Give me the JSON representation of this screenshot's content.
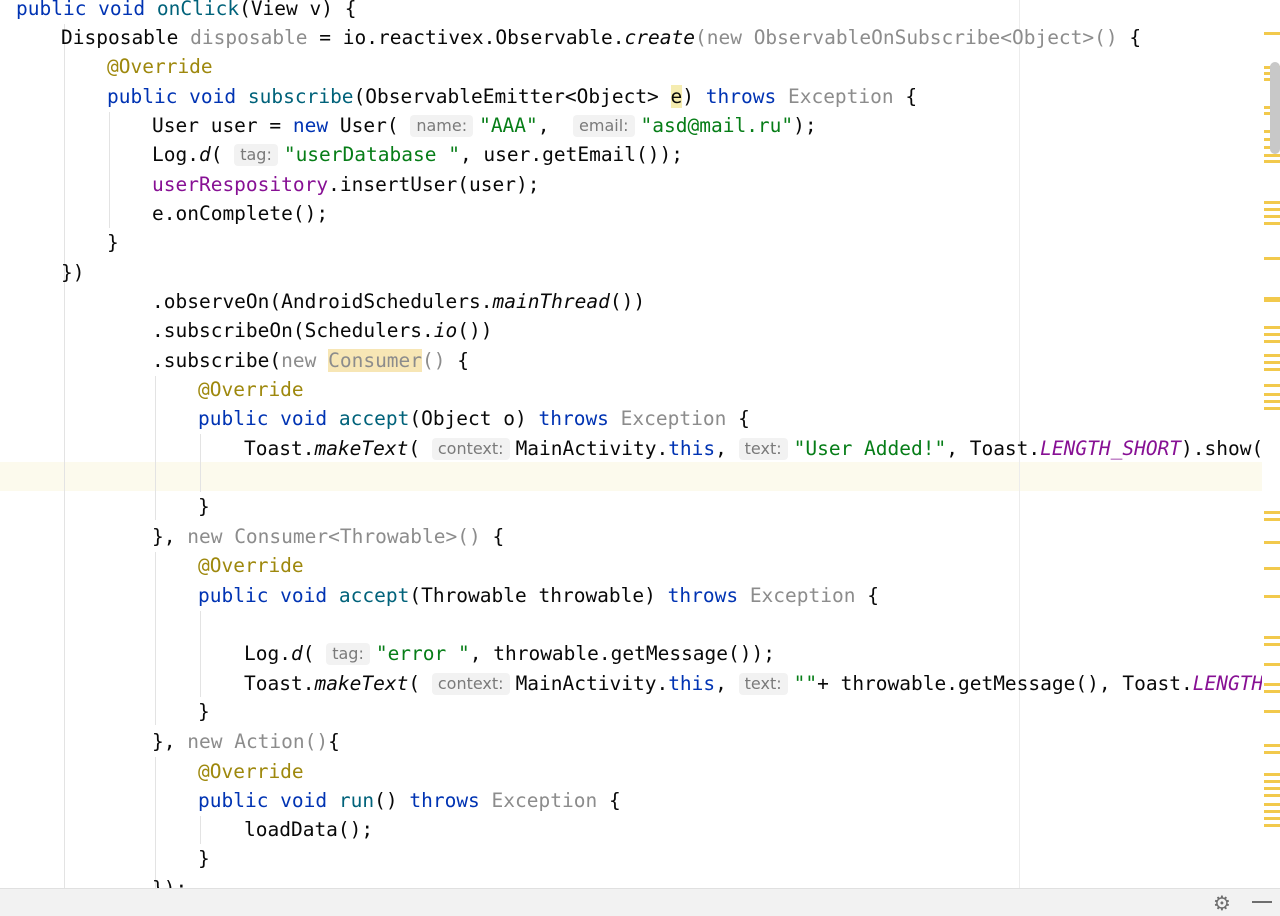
{
  "hints": {
    "name": "name:",
    "email": "email:",
    "tag": "tag:",
    "context": "context:",
    "text": "text:"
  },
  "code": {
    "l1": {
      "a": "public void ",
      "b": "onClick",
      "c": "(View v) {"
    },
    "l2": {
      "a": "Disposable ",
      "b": "disposable",
      "c": " = io.reactivex.Observable.",
      "d": "create",
      "e": "(",
      "f": "new ObservableOnSubscribe<Object>() ",
      "g": "{"
    },
    "l3": {
      "a": "@Override"
    },
    "l4": {
      "a": "public void ",
      "b": "subscribe",
      "c": "(ObservableEmitter<Object> ",
      "d": "e",
      "e": ") ",
      "f": "throws",
      "g": " Exception",
      "h": " {"
    },
    "l5": {
      "a": "User user = ",
      "b": "new",
      "c": " User( ",
      "d": "\"AAA\"",
      "e": ",  ",
      "f": "\"asd@mail.ru\"",
      "g": ");"
    },
    "l6": {
      "a": "Log.",
      "b": "d",
      "c": "( ",
      "d": "\"userDatabase \"",
      "e": ", user.getEmail());"
    },
    "l7": {
      "a": "userRespository",
      "b": ".insertUser(user);"
    },
    "l8": {
      "a": "e.onComplete();"
    },
    "l9": {
      "a": "}"
    },
    "l10": {
      "a": "})"
    },
    "l11": {
      "a": ".observeOn(AndroidSchedulers.",
      "b": "mainThread",
      "c": "())"
    },
    "l12": {
      "a": ".subscribeOn(Schedulers.",
      "b": "io",
      "c": "())"
    },
    "l13": {
      "a": ".subscribe(",
      "b": "new ",
      "c": "Consumer",
      "d": "() ",
      "e": "{"
    },
    "l14": {
      "a": "@Override"
    },
    "l15": {
      "a": "public void ",
      "b": "accept",
      "c": "(Object o) ",
      "d": "throws",
      "e": " Exception",
      "f": " {"
    },
    "l16": {
      "a": "Toast.",
      "b": "makeText",
      "c": "( ",
      "d": "MainActivity.",
      "e": "this",
      "f": ", ",
      "g": "\"User Added!\"",
      "h": ", Toast.",
      "i": "LENGTH_SHORT",
      "j": ").show();"
    },
    "l18": {
      "a": "}"
    },
    "l19": {
      "a": "}, ",
      "b": "new Consumer<Throwable>() ",
      "c": "{"
    },
    "l20": {
      "a": "@Override"
    },
    "l21": {
      "a": "public void ",
      "b": "accept",
      "c": "(Throwable throwable) ",
      "d": "throws",
      "e": " Exception",
      "f": " {"
    },
    "l23": {
      "a": "Log.",
      "b": "d",
      "c": "( ",
      "d": "\"error \"",
      "e": ", throwable.getMessage());"
    },
    "l24": {
      "a": "Toast.",
      "b": "makeText",
      "c": "( ",
      "d": "MainActivity.",
      "e": "this",
      "f": ", ",
      "g": "\"\"",
      "h": "+ throwable.getMessage(), Toast.",
      "i": "LENGTH_SH"
    },
    "l25": {
      "a": "}"
    },
    "l26": {
      "a": "}, ",
      "b": "new ",
      "c": "Action",
      "d": "()",
      "e": "{"
    },
    "l27": {
      "a": "@Override"
    },
    "l28": {
      "a": "public void ",
      "b": "run",
      "c": "() ",
      "d": "throws",
      "e": " Exception",
      "f": " {"
    },
    "l29": {
      "a": "loadData();"
    },
    "l30": {
      "a": "}"
    },
    "l31": {
      "a": "});"
    }
  },
  "icons": {
    "settings": "gear-icon",
    "hide": "minus-icon"
  }
}
